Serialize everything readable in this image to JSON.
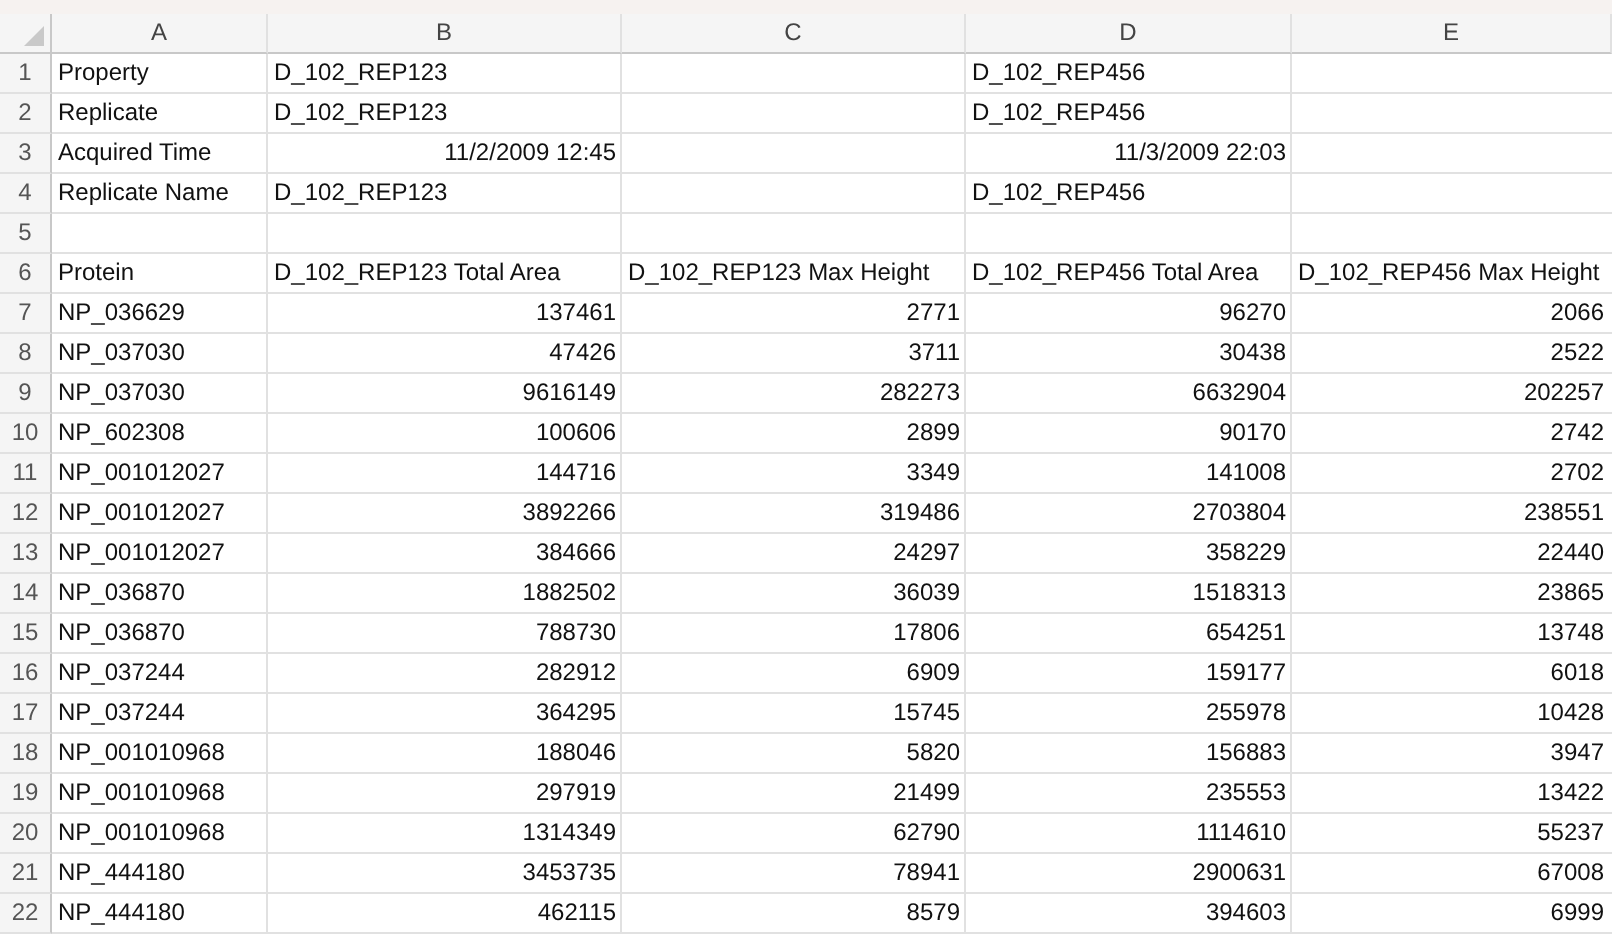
{
  "columns": [
    "A",
    "B",
    "C",
    "D",
    "E"
  ],
  "rows": [
    {
      "number": "1",
      "kind": "text",
      "cells": [
        "Property",
        "D_102_REP123",
        null,
        "D_102_REP456",
        null
      ]
    },
    {
      "number": "2",
      "kind": "text",
      "cells": [
        "Replicate",
        "D_102_REP123",
        null,
        "D_102_REP456",
        null
      ]
    },
    {
      "number": "3",
      "kind": "time",
      "cells": [
        "Acquired Time",
        "11/2/2009 12:45",
        null,
        "11/3/2009 22:03",
        null
      ]
    },
    {
      "number": "4",
      "kind": "text",
      "cells": [
        "Replicate Name",
        "D_102_REP123",
        null,
        "D_102_REP456",
        null
      ]
    },
    {
      "number": "5",
      "kind": "text",
      "cells": [
        null,
        null,
        null,
        null,
        null
      ]
    },
    {
      "number": "6",
      "kind": "text",
      "cells": [
        "Protein",
        "D_102_REP123 Total Area",
        "D_102_REP123 Max Height",
        "D_102_REP456 Total Area",
        "D_102_REP456 Max Height"
      ]
    },
    {
      "number": "7",
      "kind": "data",
      "cells": [
        "NP_036629",
        "137461",
        "2771",
        "96270",
        "2066"
      ]
    },
    {
      "number": "8",
      "kind": "data",
      "cells": [
        "NP_037030",
        "47426",
        "3711",
        "30438",
        "2522"
      ]
    },
    {
      "number": "9",
      "kind": "data",
      "cells": [
        "NP_037030",
        "9616149",
        "282273",
        "6632904",
        "202257"
      ]
    },
    {
      "number": "10",
      "kind": "data",
      "cells": [
        "NP_602308",
        "100606",
        "2899",
        "90170",
        "2742"
      ]
    },
    {
      "number": "11",
      "kind": "data",
      "cells": [
        "NP_001012027",
        "144716",
        "3349",
        "141008",
        "2702"
      ]
    },
    {
      "number": "12",
      "kind": "data",
      "cells": [
        "NP_001012027",
        "3892266",
        "319486",
        "2703804",
        "238551"
      ]
    },
    {
      "number": "13",
      "kind": "data",
      "cells": [
        "NP_001012027",
        "384666",
        "24297",
        "358229",
        "22440"
      ]
    },
    {
      "number": "14",
      "kind": "data",
      "cells": [
        "NP_036870",
        "1882502",
        "36039",
        "1518313",
        "23865"
      ]
    },
    {
      "number": "15",
      "kind": "data",
      "cells": [
        "NP_036870",
        "788730",
        "17806",
        "654251",
        "13748"
      ]
    },
    {
      "number": "16",
      "kind": "data",
      "cells": [
        "NP_037244",
        "282912",
        "6909",
        "159177",
        "6018"
      ]
    },
    {
      "number": "17",
      "kind": "data",
      "cells": [
        "NP_037244",
        "364295",
        "15745",
        "255978",
        "10428"
      ]
    },
    {
      "number": "18",
      "kind": "data",
      "cells": [
        "NP_001010968",
        "188046",
        "5820",
        "156883",
        "3947"
      ]
    },
    {
      "number": "19",
      "kind": "data",
      "cells": [
        "NP_001010968",
        "297919",
        "21499",
        "235553",
        "13422"
      ]
    },
    {
      "number": "20",
      "kind": "data",
      "cells": [
        "NP_001010968",
        "1314349",
        "62790",
        "1114610",
        "55237"
      ]
    },
    {
      "number": "21",
      "kind": "data",
      "cells": [
        "NP_444180",
        "3453735",
        "78941",
        "2900631",
        "67008"
      ]
    },
    {
      "number": "22",
      "kind": "data",
      "cells": [
        "NP_444180",
        "462115",
        "8579",
        "394603",
        "6999"
      ]
    }
  ]
}
